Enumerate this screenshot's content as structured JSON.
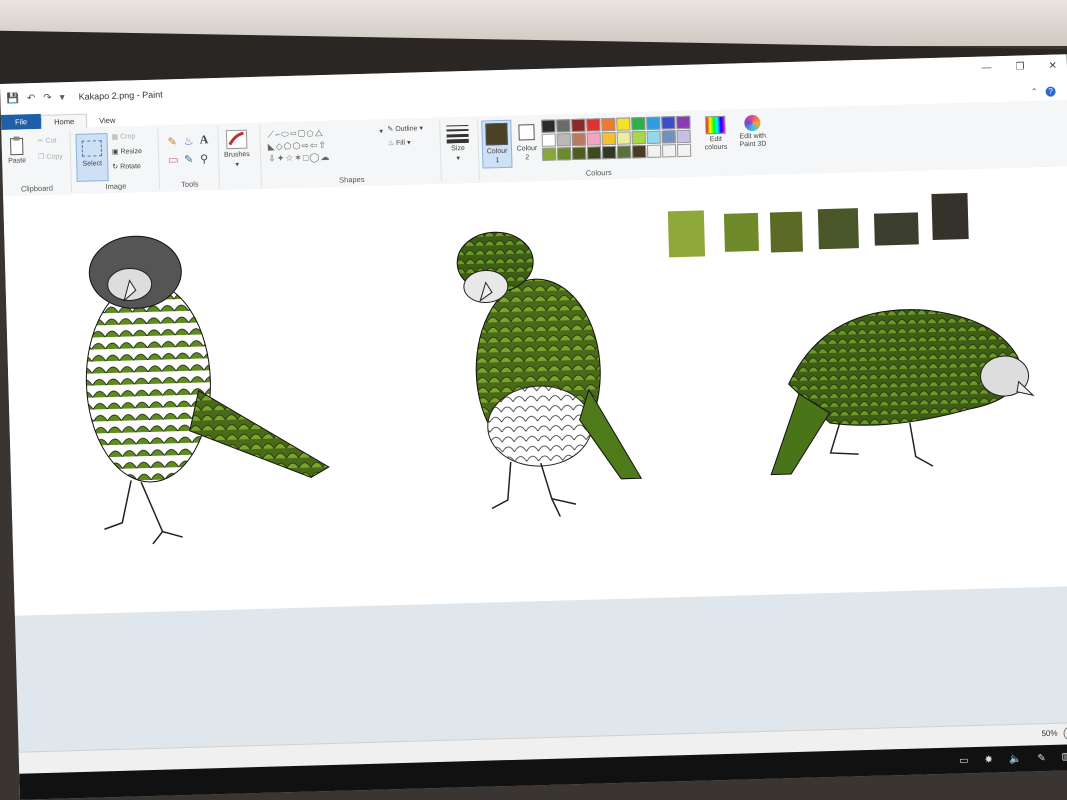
{
  "window": {
    "title": "Kakapo 2.png - Paint"
  },
  "tabs": [
    {
      "label": "File"
    },
    {
      "label": "Home"
    },
    {
      "label": "View"
    }
  ],
  "ribbon": {
    "clipboard": {
      "label": "Clipboard",
      "paste": "Paste",
      "cut": "Cut",
      "copy": "Copy"
    },
    "image": {
      "label": "Image",
      "select": "Select",
      "crop": "Crop",
      "resize": "Resize",
      "rotate": "Rotate"
    },
    "tools": {
      "label": "Tools"
    },
    "brushes": {
      "label": "Brushes"
    },
    "shapes": {
      "label": "Shapes",
      "outline": "Outline",
      "fill": "Fill"
    },
    "size": {
      "label": "Size"
    },
    "colours": {
      "label": "Colours",
      "colour1": "Colour",
      "colour1_num": "1",
      "colour2": "Colour",
      "colour2_num": "2",
      "edit": "Edit colours",
      "edit3d": "Edit with Paint 3D",
      "palette_row1": [
        "#2b2b2b",
        "#6b6b6b",
        "#8b2a2a",
        "#e0322e",
        "#f1792d",
        "#f5e32a",
        "#2fae4a",
        "#2d9fe0",
        "#3a4fc7",
        "#8a3ab5"
      ],
      "palette_row2": [
        "#ffffff",
        "#b9b9b9",
        "#b77a63",
        "#f3a2c2",
        "#f5c02b",
        "#ecec9f",
        "#a8d84a",
        "#95d8ea",
        "#7092be",
        "#c8bfe7"
      ],
      "palette_row3": [
        "#8aa63a",
        "#6b8a2a",
        "#4e5e22",
        "#3e4a1e",
        "#333825",
        "#59713d",
        "#4b3c2a",
        "#f2f2f2",
        "#f2f2f2",
        "#f2f2f2"
      ],
      "colour1_value": "#4a4026",
      "colour2_value": "#ffffff"
    }
  },
  "canvas": {
    "swatches": [
      "#8ea83a",
      "#6f8a2a",
      "#5b6b26",
      "#48562a",
      "#3b3d2e",
      "#34322a"
    ]
  },
  "status": {
    "zoom": "50%"
  }
}
